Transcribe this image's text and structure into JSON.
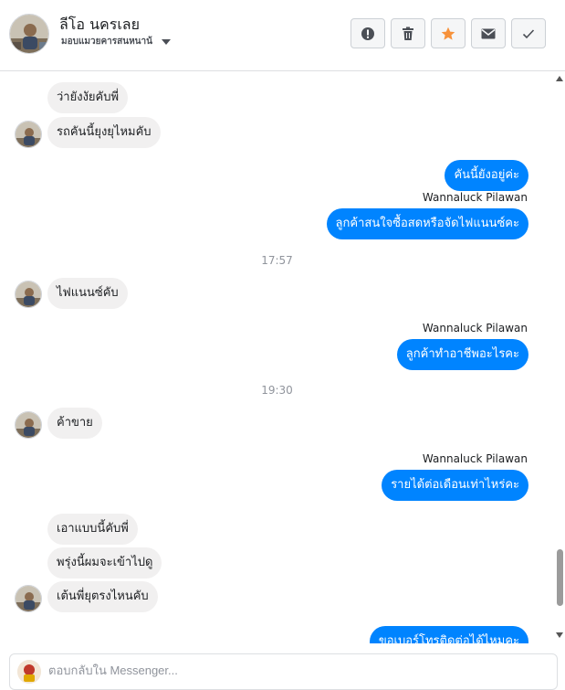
{
  "header": {
    "name": "ลีโอ นครเลย",
    "status_label": "มอบแมวยคารสนหนาน้",
    "actions": [
      {
        "name": "report-button",
        "icon": "exclamation-icon"
      },
      {
        "name": "delete-button",
        "icon": "trash-icon"
      },
      {
        "name": "star-button",
        "icon": "star-icon"
      },
      {
        "name": "mail-button",
        "icon": "envelope-icon"
      },
      {
        "name": "done-button",
        "icon": "checkmark-icon"
      }
    ],
    "colors": {
      "star": "#f7923b"
    }
  },
  "messages": [
    {
      "id": "m1",
      "side": "in",
      "text": "ว่ายังงัยคับพี่"
    },
    {
      "id": "m2",
      "side": "in",
      "text": "รถคันนี้ยุงยุไหมคับ"
    },
    {
      "id": "m3",
      "side": "out",
      "text": "คันนี้ยังอยู่ค่ะ"
    },
    {
      "id": "m4",
      "side": "out",
      "sender": "Wannaluck Pilawan",
      "text": "ลูกค้าสนใจซื้อสดหรือจัดไฟแนนซ์คะ"
    },
    {
      "id": "t1",
      "type": "time",
      "text": "17:57"
    },
    {
      "id": "m5",
      "side": "in",
      "text": "ไฟแนนซ์คับ"
    },
    {
      "id": "m6",
      "side": "out",
      "sender": "Wannaluck Pilawan",
      "text": "ลูกค้าทำอาชีพอะไรคะ"
    },
    {
      "id": "t2",
      "type": "time",
      "text": "19:30"
    },
    {
      "id": "m7",
      "side": "in",
      "text": "ค้าขาย"
    },
    {
      "id": "m8",
      "side": "out",
      "sender": "Wannaluck Pilawan",
      "text": "รายได้ต่อเดือนเท่าไหร่คะ"
    },
    {
      "id": "m9",
      "side": "in",
      "text": "เอาแบบนี้คับพี่"
    },
    {
      "id": "m10",
      "side": "in",
      "text": "พรุ่งนี้ผมจะเข้าไปดู"
    },
    {
      "id": "m11",
      "side": "in",
      "text": "เต้นพี่ยุตรงไหนคับ"
    },
    {
      "id": "m12",
      "side": "out",
      "text": "ขอเบอร์โทรติดต่อได้ไหมคะ"
    }
  ],
  "composer": {
    "placeholder": "ตอบกลับใน Messenger..."
  },
  "colors": {
    "outgoing": "#0084ff",
    "incoming": "#f1f0f0"
  }
}
